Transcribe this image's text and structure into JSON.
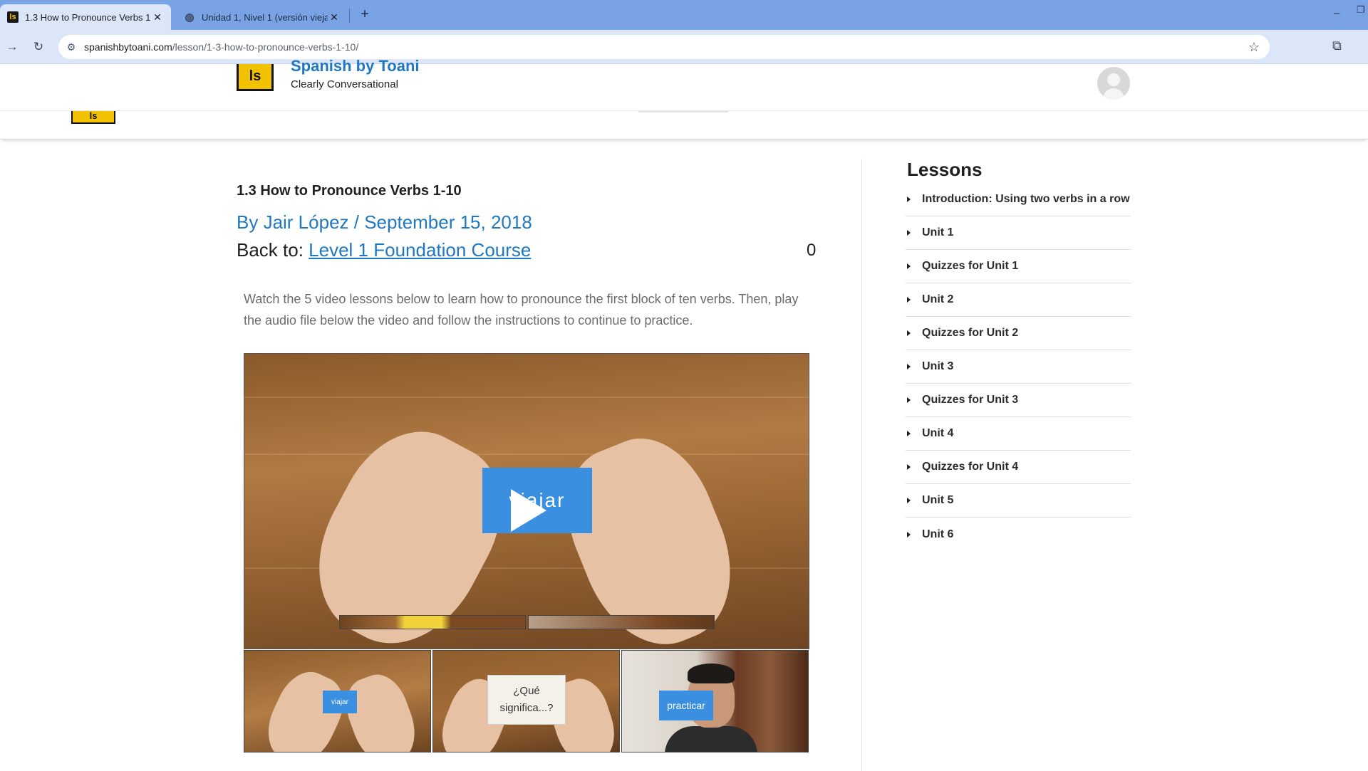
{
  "browser": {
    "tabs": [
      {
        "title": "1.3 How to Pronounce Verbs 1",
        "active": true
      },
      {
        "title": "Unidad 1, Nivel 1 (versión vieja",
        "active": false
      }
    ],
    "url_host": "spanishbytoani.com",
    "url_path": "/lesson/1-3-how-to-pronounce-verbs-1-10/",
    "icons": {
      "back": "arrow-right-icon",
      "reload": "reload-icon",
      "site_info": "tune-icon",
      "star": "star-icon",
      "extensions": "puzzle-icon"
    }
  },
  "site": {
    "brand": "Spanish by Toani",
    "tagline": "Clearly Conversational",
    "logo_text": "ls"
  },
  "lesson": {
    "title": "1.3 How to Pronounce Verbs 1-10",
    "byline": "By Jair López / September 15, 2018",
    "back_prefix": "Back to:",
    "back_link": "Level 1 Foundation Course",
    "counter": "0",
    "description": "Watch the 5 video lessons below to learn how to pronounce the first block of ten verbs. Then, play the audio file below the video and follow the instructions to continue to practice."
  },
  "video": {
    "card_text": "viajar",
    "thumbnails": [
      {
        "card_text": "viajar"
      },
      {
        "card_text": "¿Qué significa...?"
      },
      {
        "card_text": "practicar"
      }
    ]
  },
  "sidebar": {
    "title": "Lessons",
    "items": [
      {
        "label": "Introduction: Using two verbs in a row"
      },
      {
        "label": "Unit 1"
      },
      {
        "label": "Quizzes for Unit 1"
      },
      {
        "label": "Unit 2"
      },
      {
        "label": "Quizzes for Unit 2"
      },
      {
        "label": "Unit 3"
      },
      {
        "label": "Quizzes for Unit 3"
      },
      {
        "label": "Unit 4"
      },
      {
        "label": "Quizzes for Unit 4"
      },
      {
        "label": "Unit 5"
      },
      {
        "label": "Unit 6"
      }
    ]
  },
  "colors": {
    "accent": "#1f78c1",
    "tabbar": "#7aa3e5",
    "toolbar": "#dbe6f8",
    "logo_yellow": "#f2c200"
  }
}
